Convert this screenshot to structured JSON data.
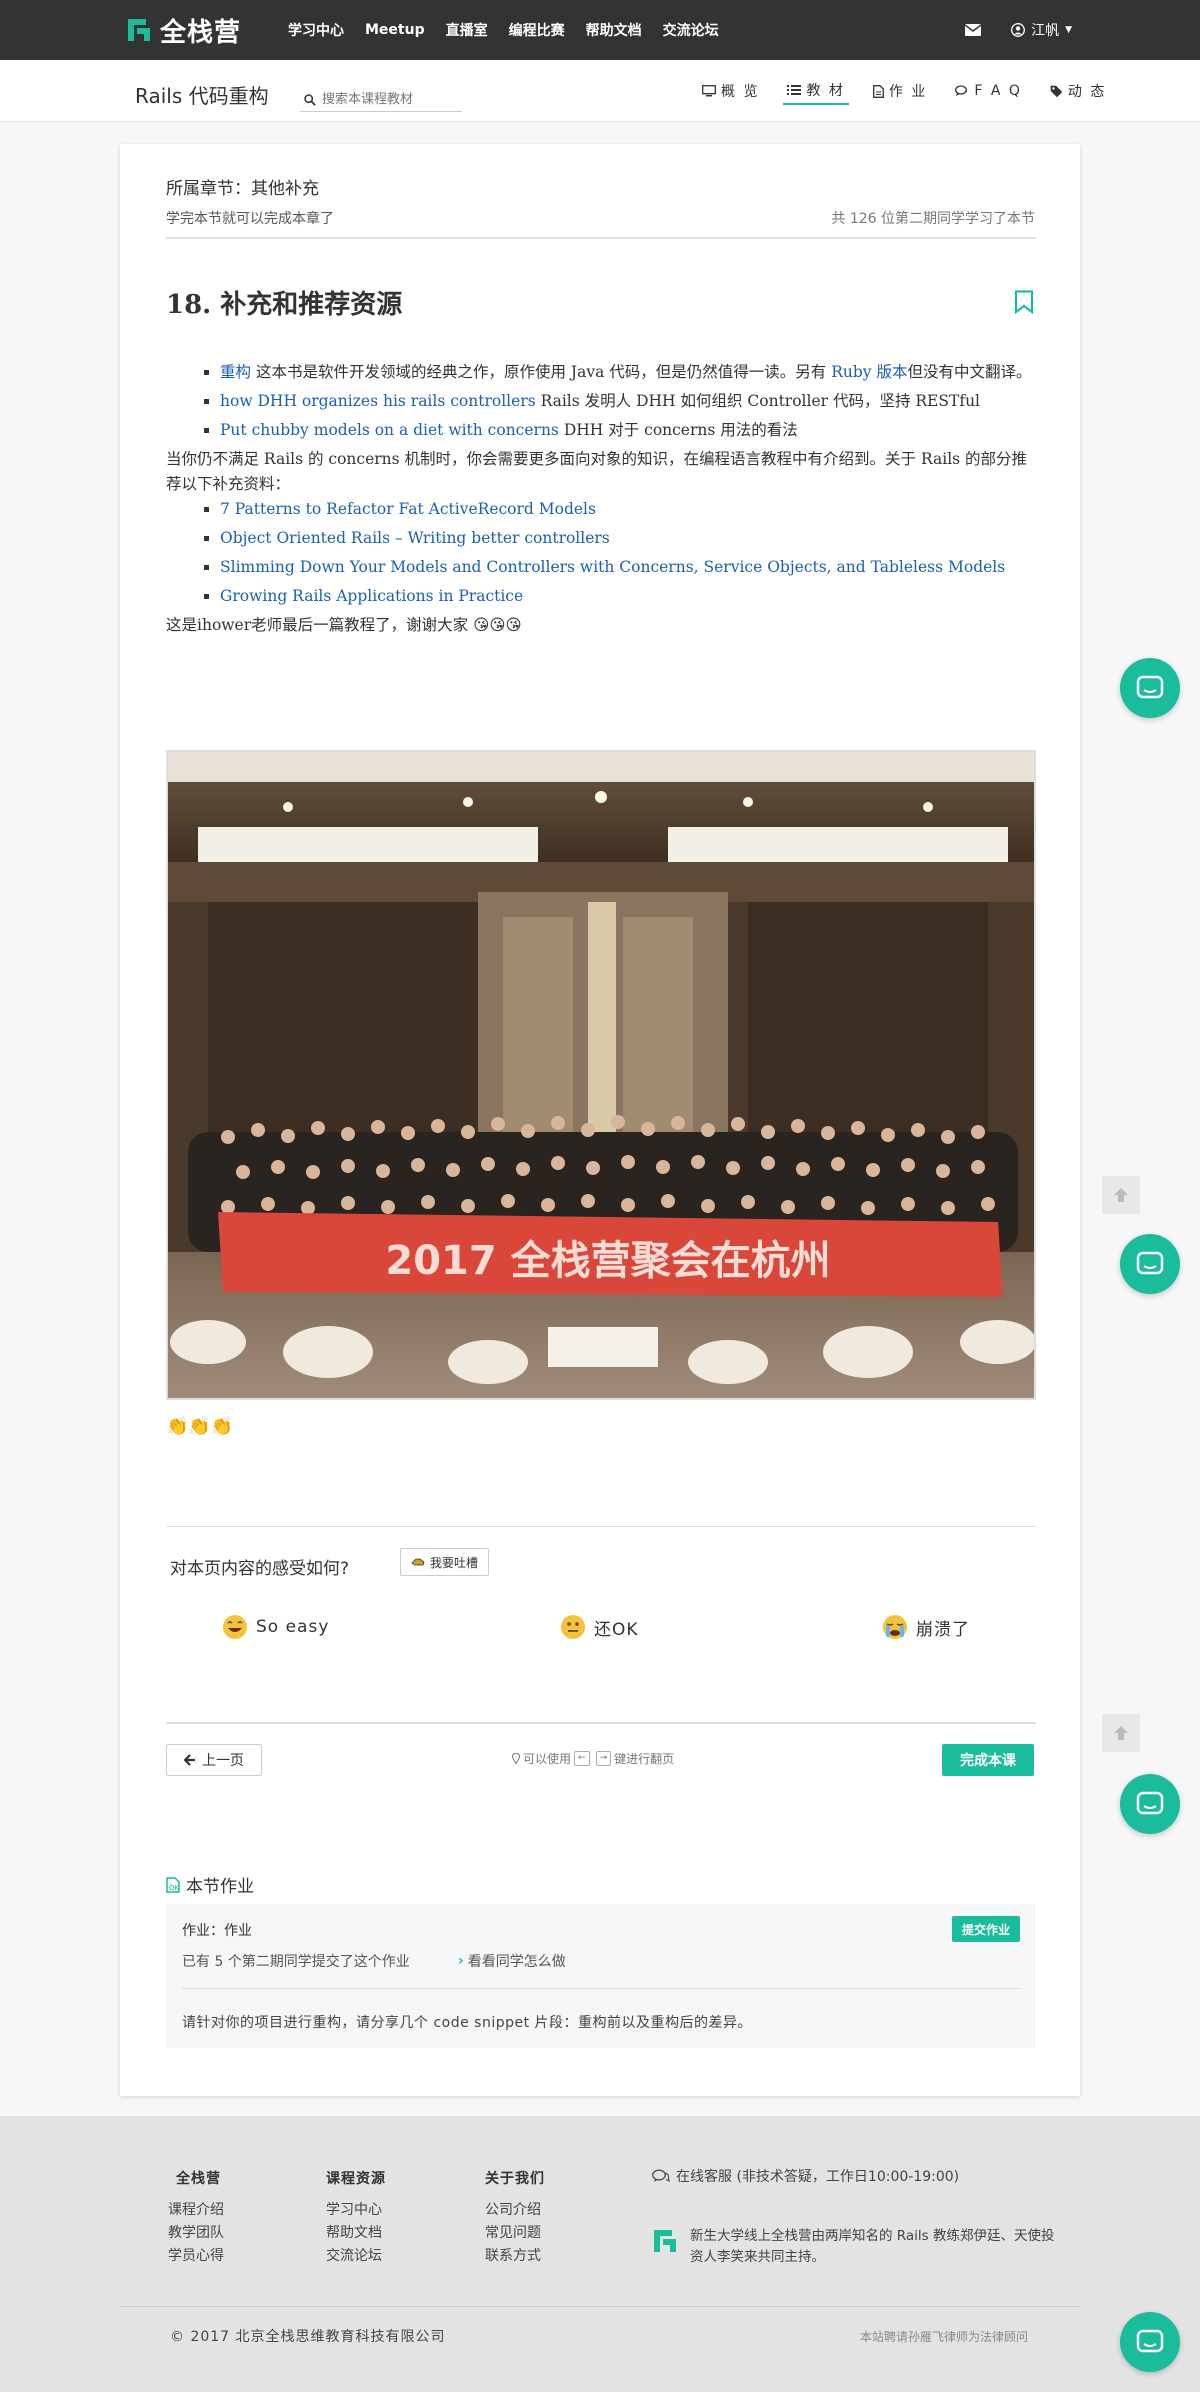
{
  "brand": {
    "name": "全栈营",
    "accent": "#1abc9c"
  },
  "nav": {
    "links": [
      "学习中心",
      "Meetup",
      "直播室",
      "编程比赛",
      "帮助文档",
      "交流论坛"
    ],
    "user_name": "江帆"
  },
  "course": {
    "title": "Rails 代码重构",
    "search_placeholder": "搜索本课程教材",
    "tabs": [
      {
        "label": "概 览",
        "icon": "monitor-icon",
        "active": false
      },
      {
        "label": "教 材",
        "icon": "list-icon",
        "active": true
      },
      {
        "label": "作 业",
        "icon": "file-icon",
        "active": false
      },
      {
        "label": "F A Q",
        "icon": "chat-icon",
        "active": false
      },
      {
        "label": "动 态",
        "icon": "tag-icon",
        "active": false
      }
    ]
  },
  "lesson": {
    "chapter_label": "所属章节：其他补充",
    "chapter_hint": "学完本节就可以完成本章了",
    "learners_text": "共 126 位第二期同学学习了本节",
    "title": "18. 补充和推荐资源",
    "list1": [
      {
        "link": "重构",
        "text": " 这本书是软件开发领域的经典之作，原作使用 Java 代码，但是仍然值得一读。另有 ",
        "link2": "Ruby 版本",
        "text2": "但没有中文翻译。"
      },
      {
        "link": "how DHH organizes his rails controllers",
        "text": " Rails 发明人 DHH 如何组织 Controller 代码，坚持 RESTful"
      },
      {
        "link": "Put chubby models on a diet with concerns",
        "text": " DHH 对于 concerns 用法的看法"
      }
    ],
    "para1": "当你仍不满足 Rails 的 concerns 机制时，你会需要更多面向对象的知识，在编程语言教程中有介绍到。关于 Rails 的部分推荐以下补充资料：",
    "list2": [
      "7 Patterns to Refactor Fat ActiveRecord Models",
      "Object Oriented Rails – Writing better controllers",
      "Slimming Down Your Models and Controllers with Concerns, Service Objects, and Tableless Models",
      "Growing Rails Applications in Practice"
    ],
    "para2": "这是ihower老师最后一篇教程了，谢谢大家",
    "para2_emoji": "😘😘😘",
    "photo_banner": "2017 全栈营聚会在杭州",
    "clap_emoji": "👏👏👏"
  },
  "feedback": {
    "question": "对本页内容的感受如何?",
    "complain_label": "我要吐槽",
    "ratings": [
      "So easy",
      "还OK",
      "崩溃了"
    ]
  },
  "pager": {
    "prev_label": "上一页",
    "hint_prefix": "可以使用",
    "hint_suffix": "键进行翻页",
    "key_left": "←",
    "key_right": "→",
    "complete_label": "完成本课"
  },
  "homework": {
    "section_title": "本节作业",
    "name": "作业：作业",
    "submit_label": "提交作业",
    "count_text": "已有 5 个第二期同学提交了这个作业",
    "see_label": "看看同学怎么做",
    "description": "请针对你的项目进行重构，请分享几个 code snippet 片段：重构前以及重构后的差异。"
  },
  "footer": {
    "col1": {
      "head": "全栈营",
      "items": [
        "课程介绍",
        "教学团队",
        "学员心得"
      ]
    },
    "col2": {
      "head": "课程资源",
      "items": [
        "学习中心",
        "帮助文档",
        "交流论坛"
      ]
    },
    "col3": {
      "head": "关于我们",
      "items": [
        "公司介绍",
        "常见问题",
        "联系方式"
      ]
    },
    "service": "在线客服 (非技术答疑，工作日10:00-19:00)",
    "about": "新生大学线上全栈营由两岸知名的 Rails 教练郑伊廷、天使投资人李笑来共同主持。",
    "copyright": "© 2017 北京全栈思维教育科技有限公司",
    "legal": "本站聘请孙雁飞律师为法律顾问"
  }
}
